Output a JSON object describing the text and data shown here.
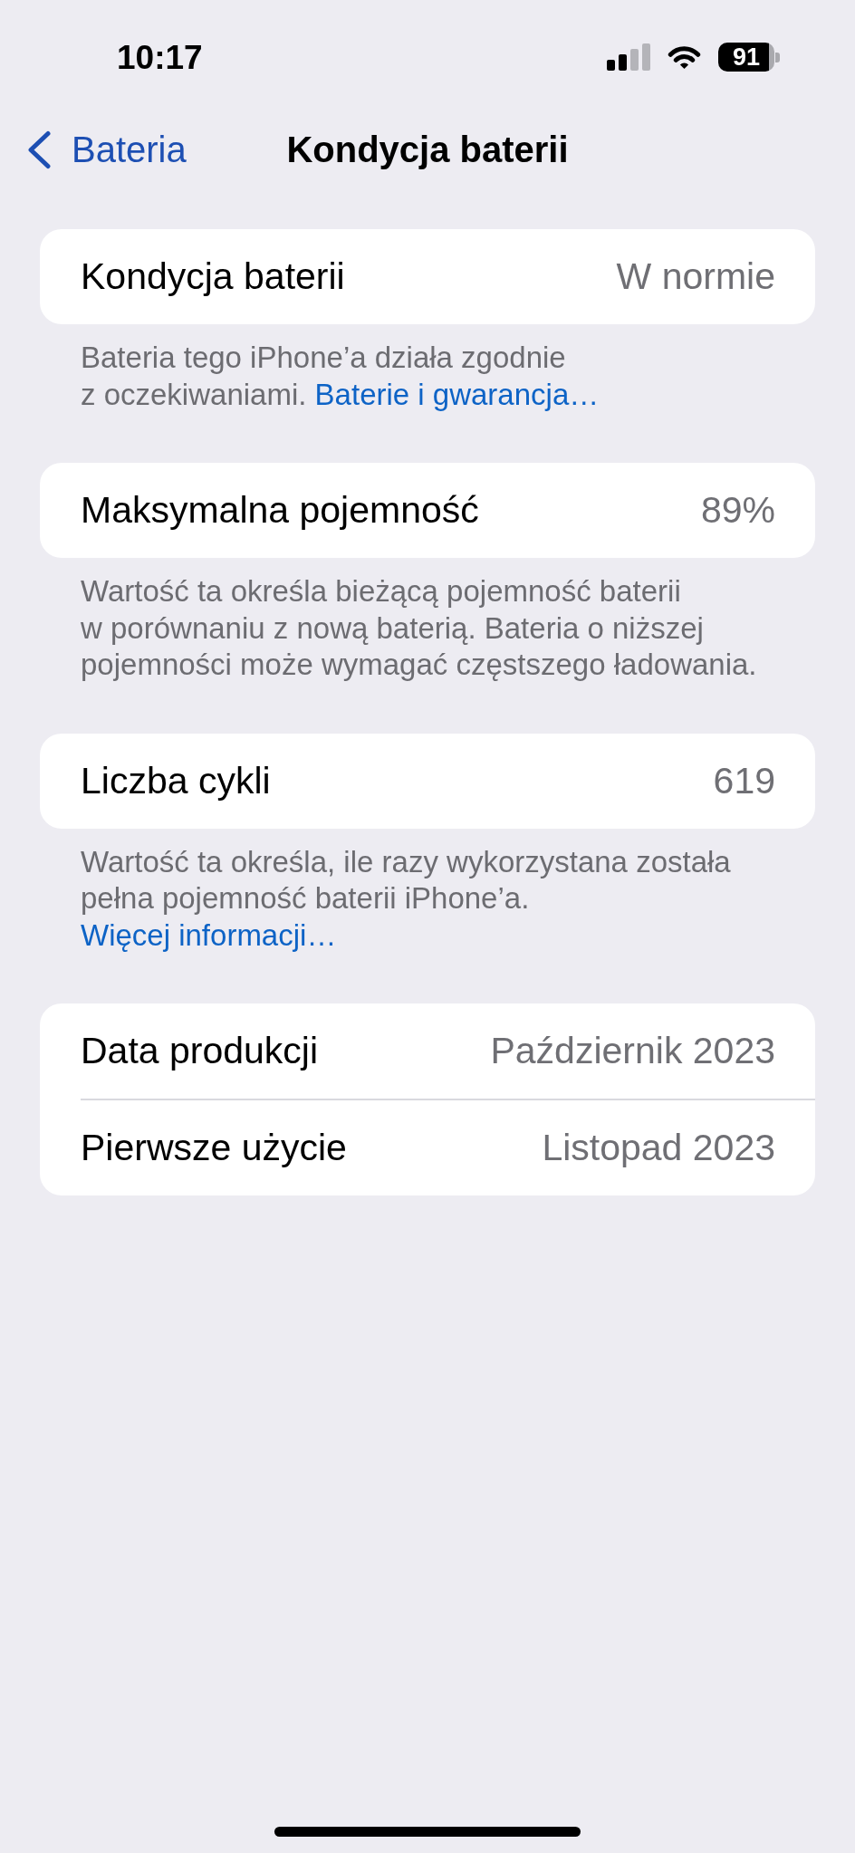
{
  "status_bar": {
    "time": "10:17",
    "battery": "91"
  },
  "nav_bar": {
    "back": "Bateria",
    "title": "Kondycja baterii"
  },
  "sections": [
    {
      "rows": [
        {
          "label": "Kondycja baterii",
          "value": "W normie"
        }
      ],
      "footer": {
        "text": "Bateria tego iPhone’a działa zgodnie\nz oczekiwaniami.",
        "link": "Baterie i gwarancja…",
        "link_on_new_line": false
      }
    },
    {
      "rows": [
        {
          "label": "Maksymalna pojemność",
          "value": "89%"
        }
      ],
      "footer": {
        "text": "Wartość ta określa bieżącą pojemność baterii\nw porównaniu z nową baterią. Bateria o niższej\npojemności może wymagać częstszego ładowania."
      }
    },
    {
      "rows": [
        {
          "label": "Liczba cykli",
          "value": "619"
        }
      ],
      "footer": {
        "text": "Wartość ta określa, ile razy wykorzystana została\npełna pojemność baterii iPhone’a.",
        "link": "Więcej informacji…",
        "link_on_new_line": true
      }
    },
    {
      "rows": [
        {
          "label": "Data produkcji",
          "value": "Październik 2023"
        },
        {
          "label": "Pierwsze użycie",
          "value": "Listopad 2023"
        }
      ]
    }
  ]
}
